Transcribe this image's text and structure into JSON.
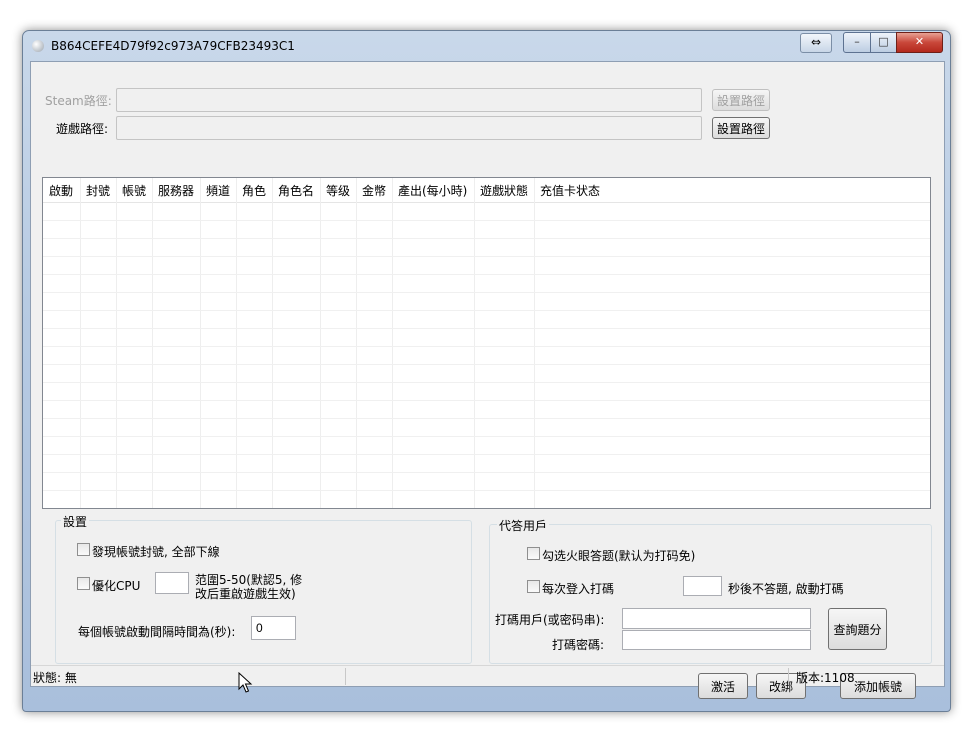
{
  "window": {
    "title": "B864CEFE4D79f92c973A79CFB23493C1",
    "snap_glyph": "⇔",
    "min_glyph": "–",
    "max_glyph": "□",
    "close_glyph": "✕"
  },
  "paths": {
    "steam_label": "Steam路徑:",
    "game_label": "遊戲路徑:",
    "steam_button": "設置路徑",
    "game_button": "設置路徑"
  },
  "table": {
    "columns": [
      "啟動",
      "封號",
      "帳號",
      "服務器",
      "頻道",
      "角色",
      "角色名",
      "等级",
      "金幣",
      "產出(每小時)",
      "遊戲狀態",
      "充值卡状态"
    ],
    "rows": []
  },
  "settings": {
    "title": "設置",
    "ban_offline_label": "發現帳號封號, 全部下線",
    "optimize_cpu_label": "優化CPU",
    "cpu_value": "",
    "cpu_hint_line1": "范圍5-50(默認5, 修",
    "cpu_hint_line2": "改后重啟遊戲生效)",
    "interval_label": "每個帳號啟動間隔時間為(秒):",
    "interval_value": "0"
  },
  "captcha": {
    "title": "代答用戶",
    "fire_eye_label": "勾选火眼答题(默认为打码免)",
    "login_captcha_label": "每次登入打碼",
    "seconds_value": "",
    "seconds_suffix": "秒後不答題, 啟動打碼",
    "user_label": "打碼用戶(或密码串):",
    "user_value": "",
    "password_label": "打碼密碼:",
    "password_value": "",
    "query_button": "查詢題分"
  },
  "actions": {
    "activate": "激活",
    "rebind": "改綁",
    "add_account": "添加帳號"
  },
  "status": {
    "state": "狀態: 無",
    "middle": "",
    "version": "版本:1108"
  }
}
